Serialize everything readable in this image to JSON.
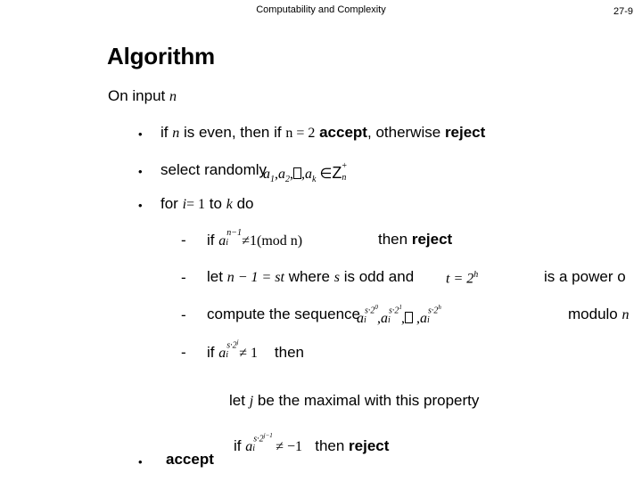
{
  "header": {
    "title": "Computability and Complexity",
    "page_number": "27-9"
  },
  "slide": {
    "title": "Algorithm",
    "intro_text": "On input",
    "intro_var": "n",
    "bullet_glyph": "•",
    "dash_glyph": "-"
  },
  "steps": [
    {
      "level": "bullet",
      "parts": {
        "p1": "if",
        "var_n": "n",
        "p2": "is even,  then if",
        "eq": "n = 2",
        "accept": "accept",
        "comma": ",",
        "otherwise": "otherwise",
        "reject": "reject"
      }
    },
    {
      "level": "bullet",
      "parts": {
        "p1": "select randomly",
        "math_a1": "a",
        "math_sub1": "1",
        "math_comma1": ",",
        "math_a2": "a",
        "math_sub2": "2",
        "math_comma2": ",",
        "math_ellipsis_box": "□",
        "math_comma3": ",",
        "math_ak": "a",
        "math_subk": "k",
        "math_in": "∈",
        "math_Z": "Z",
        "math_Zsup": "+",
        "math_Zsub": "n"
      }
    },
    {
      "level": "bullet",
      "parts": {
        "p1": "for",
        "var_i": "i",
        "eq": "= 1",
        "to": "to",
        "var_k": "k",
        "do": "do"
      }
    },
    {
      "level": "dash",
      "parts": {
        "p1": "if",
        "base": "a",
        "base_sub": "i",
        "base_sup": "n−1",
        "neq": "≠",
        "rhs": "1(mod n)",
        "then": "then",
        "reject": "reject"
      }
    },
    {
      "level": "dash",
      "parts": {
        "p1": "let",
        "eq": "n − 1 = st",
        "where": "where",
        "var_s": "s",
        "isodd": "is odd and",
        "t_eq": "t = 2",
        "t_sup": "h",
        "tail": "is a power o"
      }
    },
    {
      "level": "dash",
      "parts": {
        "p1": "compute the sequence",
        "m1_base": "a",
        "m1_sub": "i",
        "m1_sup": "s·2",
        "m1_supsup": "0",
        "comma1": ",",
        "m2_base": "a",
        "m2_sub": "i",
        "m2_sup": "s·2",
        "m2_supsup": "1",
        "comma2": ",",
        "ellipsis_box": "□",
        "comma3": ",",
        "m3_base": "a",
        "m3_sub": "i",
        "m3_sup": "s·2",
        "m3_supsup": "h",
        "modulo": "modulo",
        "mod_var": "n"
      }
    },
    {
      "level": "dash",
      "parts": {
        "p1": "if",
        "base": "a",
        "base_sub": "i",
        "base_sup": "s·2",
        "base_supsup": "j",
        "neq": "≠ 1",
        "then": "then"
      }
    },
    {
      "level": "plain",
      "parts": {
        "p1": "let",
        "var_j": "j",
        "p2": "be the maximal with this property"
      }
    },
    {
      "level": "plain",
      "parts": {
        "p1": "if",
        "base": "a",
        "base_sub": "i",
        "base_sup": "s·2",
        "base_supsup": "j−1",
        "neq": "≠ −1",
        "then": "then",
        "reject": "reject"
      }
    },
    {
      "level": "bullet",
      "parts": {
        "accept": "accept"
      }
    }
  ],
  "colors": {
    "background": "#ffffff",
    "text": "#000000"
  }
}
